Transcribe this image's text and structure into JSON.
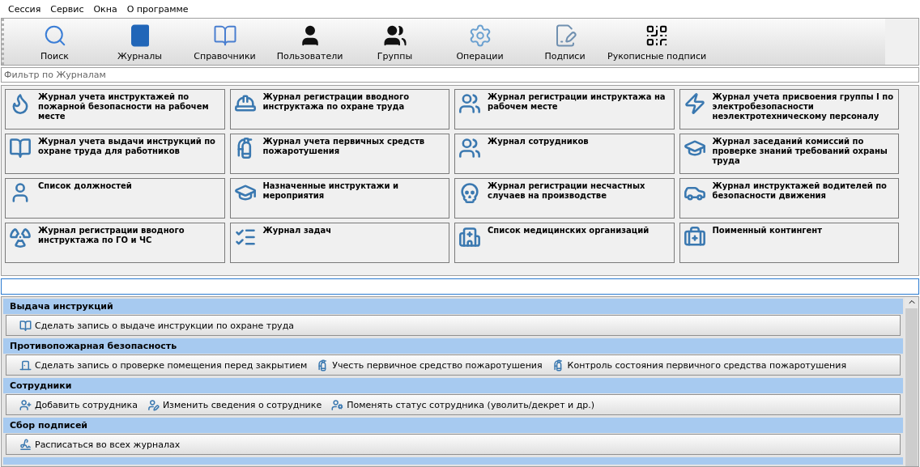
{
  "menu": [
    "Сессия",
    "Сервис",
    "Окна",
    "О программе"
  ],
  "toolbar": [
    "Поиск",
    "Журналы",
    "Справочники",
    "Пользователи",
    "Группы",
    "Операции",
    "Подписи",
    "Рукописные подписи"
  ],
  "filter": {
    "value": "Фильтр по Журналам"
  },
  "journals": [
    "Журнал учета инструктажей по пожарной безопасности на рабочем месте",
    "Журнал регистрации вводного инструктажа по охране труда",
    "Журнал регистрации инструктажа на рабочем месте",
    "Журнал учета присвоения группы I по электробезопасности неэлектротехническому персоналу",
    "Журнал учета выдачи инструкций по охране труда для работников",
    "Журнал учета первичных средств пожаротушения",
    "Журнал сотрудников",
    "Журнал заседаний комиссий по проверке знаний требований охраны труда",
    "Список должностей",
    "Назначенные инструктажи и мероприятия",
    "Журнал регистрации несчастных случаев на производстве",
    "Журнал инструктажей водителей по безопасности движения",
    "Журнал регистрации вводного инструктажа по ГО и ЧС",
    "Журнал задач",
    "Список медицинских организаций",
    "Поименный контингент"
  ],
  "sections": [
    {
      "title": "Выдача инструкций",
      "actions": [
        "Сделать запись о выдаче инструкции по охране труда"
      ]
    },
    {
      "title": "Противопожарная безопасность",
      "actions": [
        "Сделать запись о проверке помещения перед закрытием",
        "Учесть первичное средство пожаротушения",
        "Контроль состояния первичного средства пожаротушения"
      ]
    },
    {
      "title": "Сотрудники",
      "actions": [
        "Добавить сотрудника",
        "Изменить сведения о сотруднике",
        "Поменять статус сотрудника (уволить/декрет и др.)"
      ]
    },
    {
      "title": "Сбор подписей",
      "actions": [
        "Расписаться во всех журналах"
      ]
    }
  ]
}
